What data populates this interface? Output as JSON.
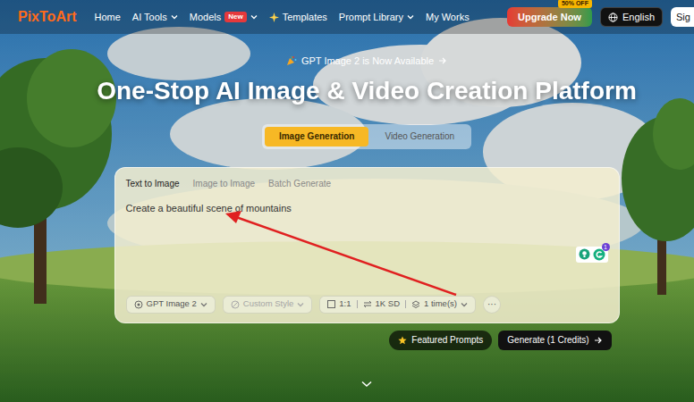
{
  "logo": "PixToArt",
  "nav": [
    {
      "label": "Home",
      "dropdown": false
    },
    {
      "label": "AI Tools",
      "dropdown": true
    },
    {
      "label": "Models",
      "badge": "New",
      "dropdown": true
    },
    {
      "label": "Templates",
      "dropdown": false
    },
    {
      "label": "Prompt Library",
      "dropdown": true
    },
    {
      "label": "My Works",
      "dropdown": false
    }
  ],
  "upgrade": {
    "label": "Upgrade Now",
    "badge": "50% OFF"
  },
  "language": "English",
  "sign_in": "Sig",
  "announcement": "GPT Image 2 is Now Available",
  "headline": "One-Stop AI Image & Video Creation Platform",
  "mode_tabs": [
    {
      "label": "Image Generation",
      "selected": true
    },
    {
      "label": "Video Generation",
      "selected": false
    }
  ],
  "input_tabs": [
    {
      "label": "Text to Image",
      "selected": true
    },
    {
      "label": "Image to Image",
      "selected": false
    },
    {
      "label": "Batch Generate",
      "selected": false
    }
  ],
  "prompt": "Create a beautiful scene of mountains",
  "extension_badge": "1",
  "model": {
    "label": "GPT Image 2",
    "disabled": false
  },
  "style": {
    "label": "Custom Style",
    "disabled": true
  },
  "settings": {
    "ratio": "1:1",
    "quality": "1K SD",
    "count": "1 time(s)"
  },
  "more": "···",
  "featured": "Featured Prompts",
  "generate": "Generate (1 Credits)"
}
